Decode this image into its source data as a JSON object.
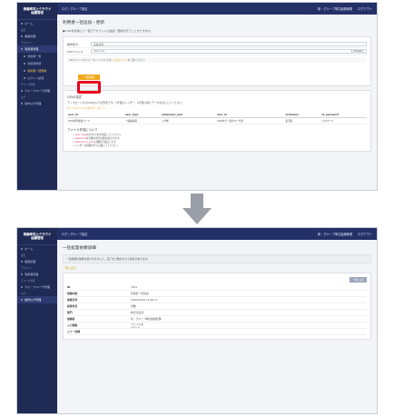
{
  "app": {
    "brand_line1": "稼働率向上クラウド",
    "brand_line2": "組織管理",
    "breadcrumb": "ログ / グループ設定",
    "notice_link": "新・グループ単位組織管理",
    "logout": "ログアウト"
  },
  "sidebar": {
    "items": [
      {
        "label": "ホーム",
        "type": "item"
      },
      {
        "label": "設定",
        "type": "sect"
      },
      {
        "label": "組織管理",
        "type": "item"
      },
      {
        "label": "アカウント",
        "type": "sect"
      },
      {
        "label": "利用者管理",
        "type": "active"
      },
      {
        "label": "利用者一覧",
        "type": "sub"
      },
      {
        "label": "利用者登録",
        "type": "sub"
      },
      {
        "label": "利用者一括登録",
        "type": "sub-hl"
      },
      {
        "label": "ログイン記録",
        "type": "sub"
      },
      {
        "label": "グループ管理",
        "type": "sect"
      },
      {
        "label": "グループ/ユーザ管理",
        "type": "item"
      },
      {
        "label": "ログ",
        "type": "sect"
      },
      {
        "label": "操作ログ管理",
        "type": "item"
      }
    ],
    "bottom_items": [
      {
        "label": "ホーム",
        "type": "item"
      },
      {
        "label": "設定",
        "type": "sect"
      },
      {
        "label": "組織管理",
        "type": "item"
      },
      {
        "label": "アカウント",
        "type": "sect"
      },
      {
        "label": "利用者管理",
        "type": "item"
      },
      {
        "label": "グループ管理",
        "type": "sect"
      },
      {
        "label": "グループ/ユーザ管理",
        "type": "item"
      },
      {
        "label": "ログ",
        "type": "sect"
      },
      {
        "label": "操作ログ管理",
        "type": "active"
      }
    ]
  },
  "top_page": {
    "title": "利用者一括追加・更新",
    "info": "CSVを利用して一括でアカウントの追加・更新を行うことができます。",
    "form": {
      "action_label": "操作区分",
      "action_value": "追加/更新",
      "file_label": "CSVファイル",
      "file_value": "users.csv",
      "browse": "Browse",
      "note": "CSVファイルのフォーマットについては",
      "note_link": "こちらのページ",
      "note_tail": "をご覧ください。",
      "upload_button": "一括登録"
    },
    "csv_section": {
      "title": "CSVの書式",
      "para1": "アップロードするCSVは以下の形式です。1行目はヘッダー、2行目以降にデータを記入してください。",
      "para2": "サンプルファイルをダウンロード",
      "headers": [
        "user_id",
        "user_type",
        "admission_year",
        "user_id",
        "nickname",
        "ck_password"
      ],
      "row": [
        "CSVの利用者コード",
        "一般会員等",
        "入学年",
        "CSV内で一意のユーザ名",
        "表示名",
        "パスワード"
      ]
    },
    "notes": {
      "title": "ファイル作成について",
      "bullets": [
        {
          "code": "user_type",
          "text": "はCSVで必ず指定してください。"
        },
        {
          "code": "password",
          "text": "は空欄の場合自動生成されます。"
        },
        {
          "code": "admission_year",
          "text": "は数値で指定します。"
        },
        {
          "code": "",
          "text": "ヘッダーは省略せずに記載してください。"
        }
      ]
    }
  },
  "bottom_page": {
    "title": "一括処理依頼詳細",
    "alert": "一括処理の依頼を受け付けました。完了まで数分かかる場合があります。",
    "link": "一覧に戻る",
    "back_button": "一覧に戻る",
    "fields": [
      {
        "key": "ID",
        "value": "1001"
      },
      {
        "key": "依頼内容",
        "value": "利用者一括追加"
      },
      {
        "key": "依頼日時",
        "value": "2020/02/20 11:08:17"
      },
      {
        "key": "処理状況",
        "value": "待機"
      },
      {
        "key": "部門",
        "value": "総合企画部"
      },
      {
        "key": "依頼者",
        "value": "新・グループ単位組織管理"
      },
      {
        "key": "入力情報",
        "value": "ファイル名",
        "sub": "users.csv"
      },
      {
        "key": "エラー詳細",
        "value": ""
      }
    ]
  },
  "colors": {
    "sidebar": "#1f2a55",
    "topbar": "#243068",
    "accent": "#f0a81d",
    "highlight": "#e8001b"
  }
}
